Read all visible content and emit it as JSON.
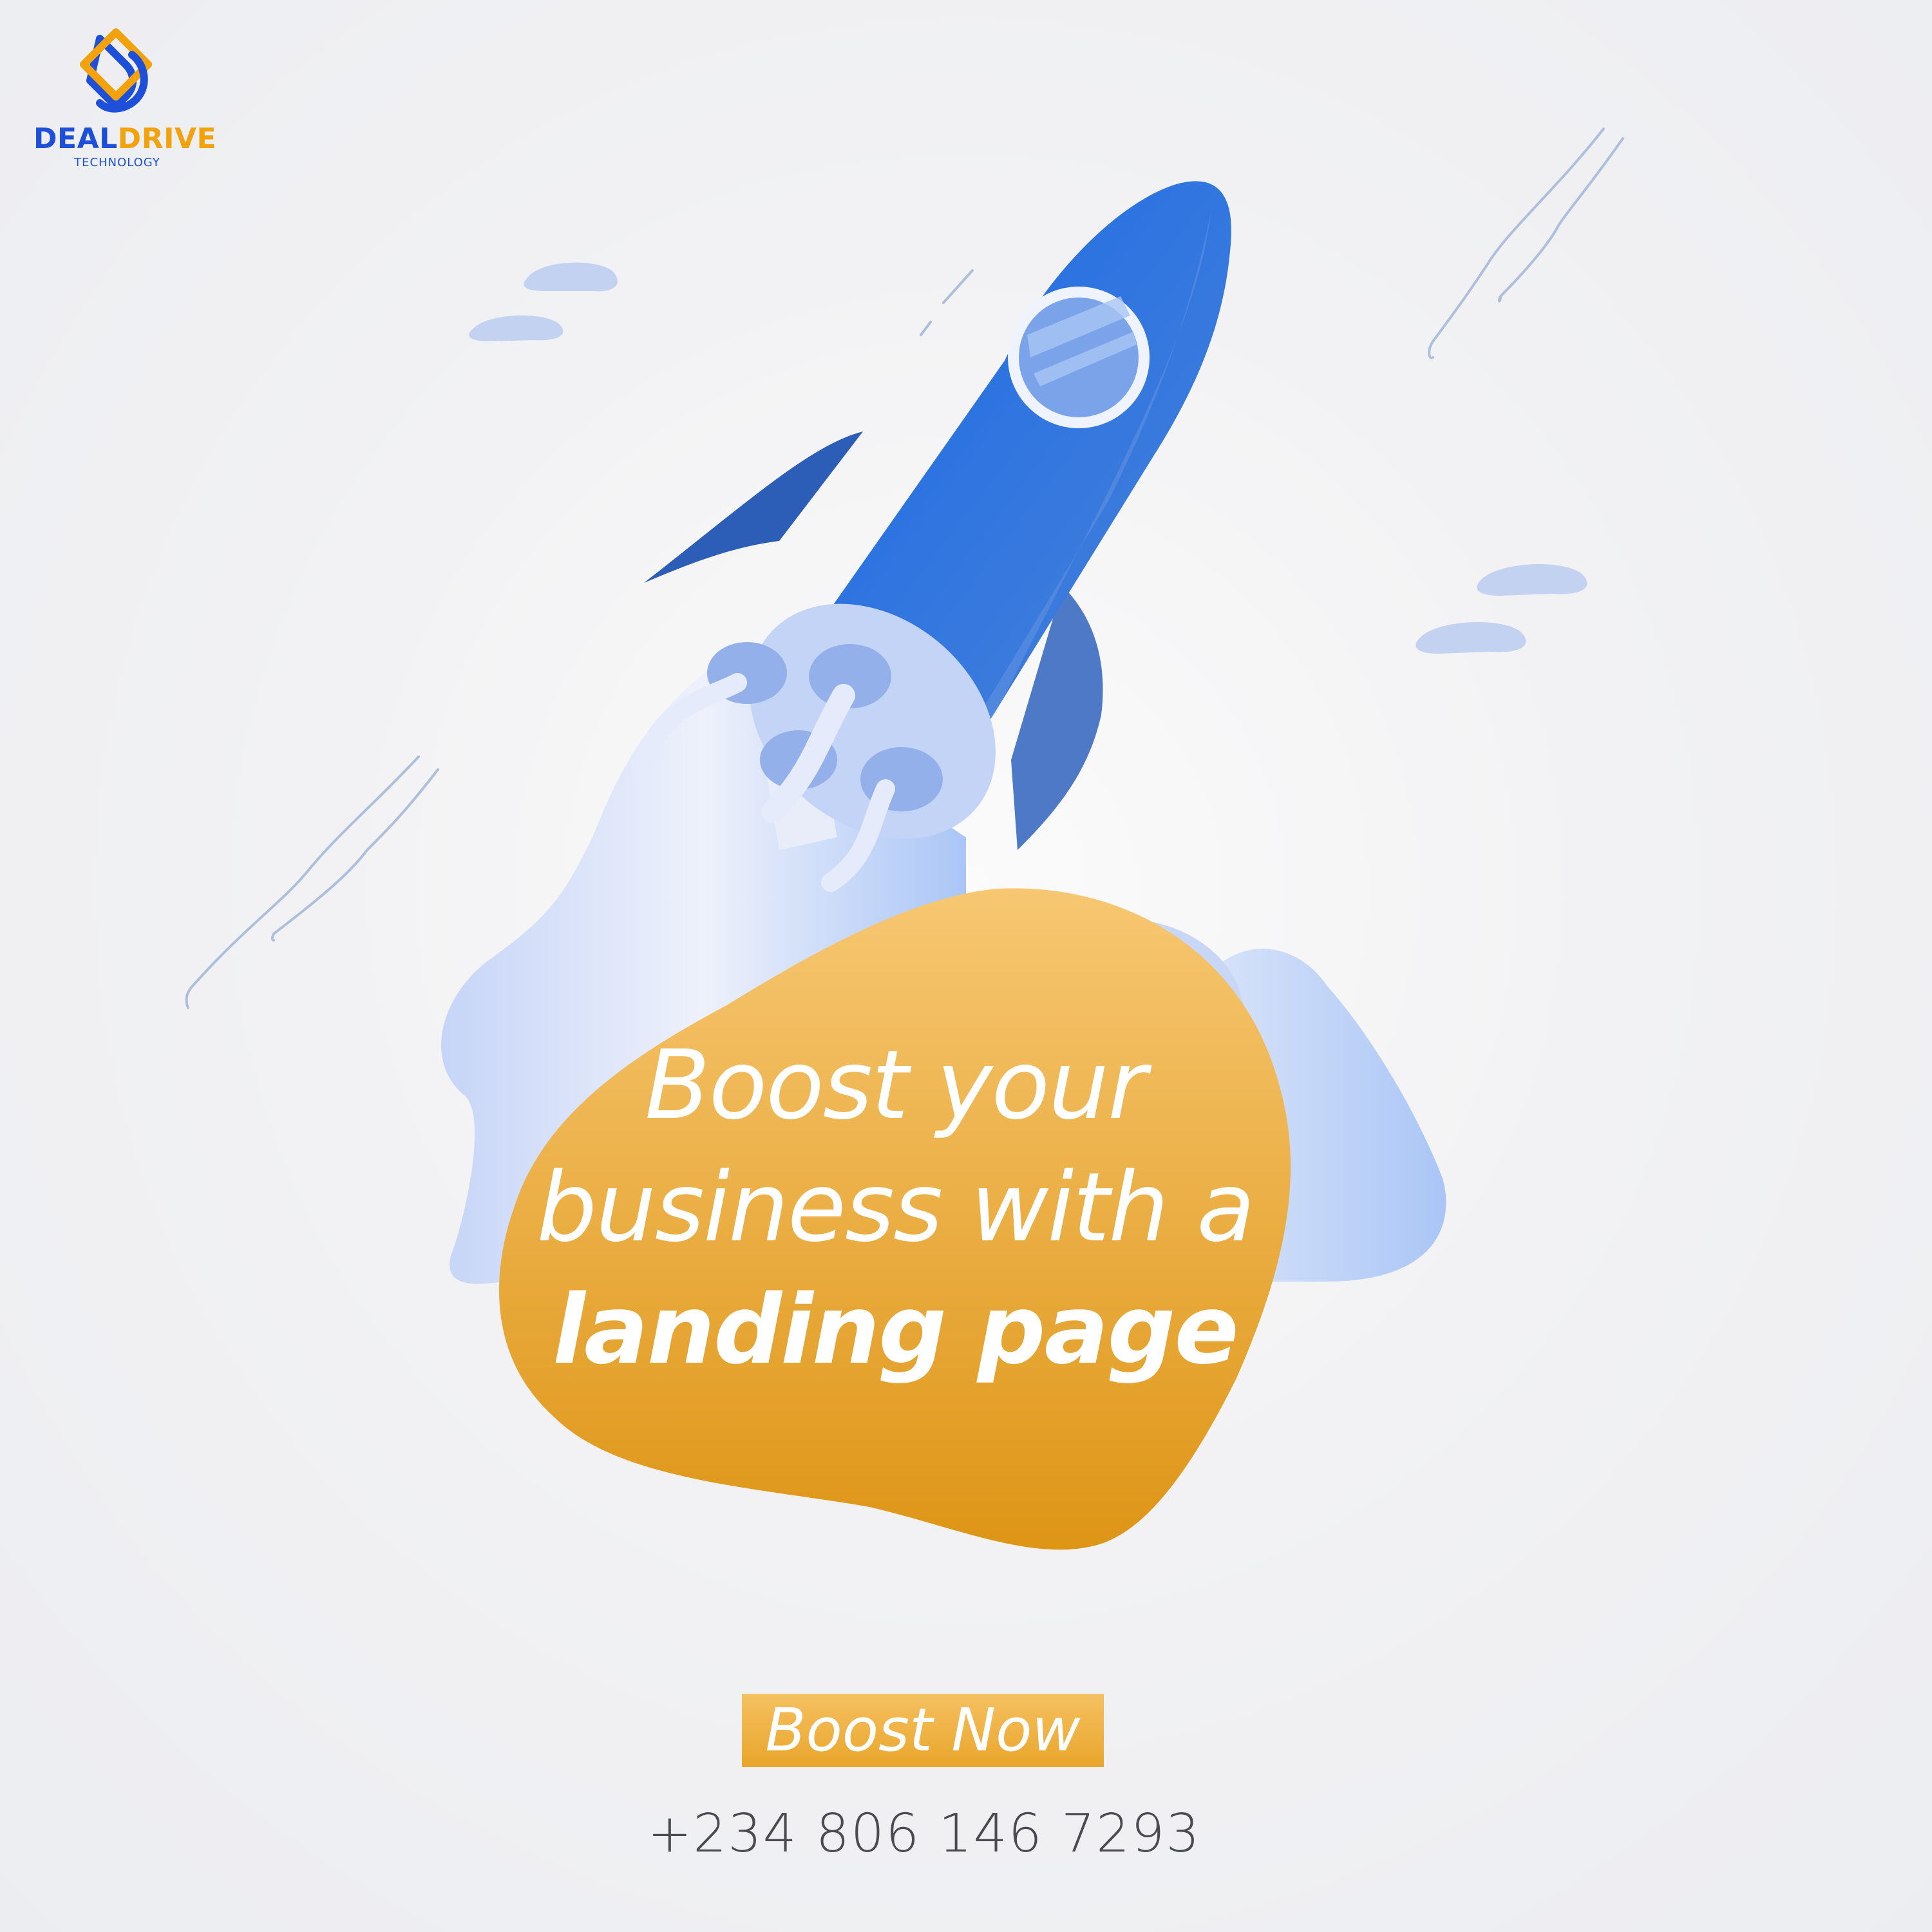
{
  "brand": {
    "name_part1": "DEAL",
    "name_part2": "DRIVE",
    "tagline": "TECHNOLOGY",
    "icon": "diamond-logo-icon",
    "colors": {
      "blue": "#1d4fd8",
      "orange": "#f2a20c"
    }
  },
  "hero": {
    "line1": "Boost your",
    "line2": "business with a",
    "line3": "landing page",
    "illustration": "rocket-icon",
    "colors": {
      "rocket": "#1e6de4",
      "blob": "#f0b64a",
      "smoke": "#c7d6f6"
    }
  },
  "cta": {
    "label": "Boost Now",
    "color": "#efb03f"
  },
  "contact": {
    "phone": "+234 806 146 7293"
  }
}
